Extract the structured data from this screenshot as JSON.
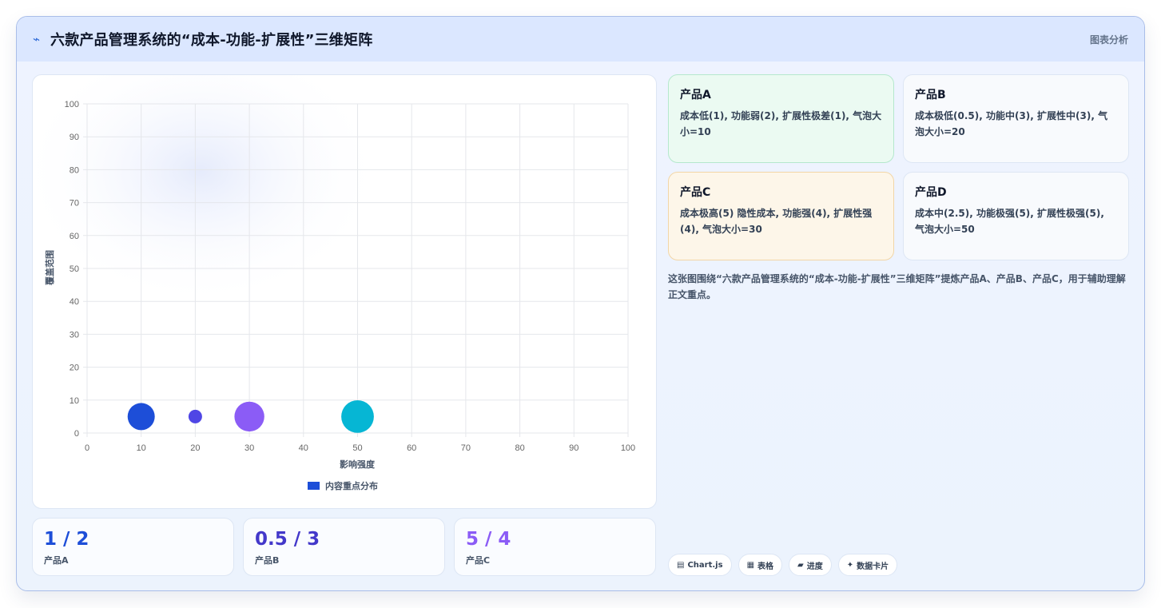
{
  "header": {
    "logo_icon": "⌁",
    "title": "六款产品管理系统的“成本-功能-扩展性”三维矩阵",
    "tag": "图表分析"
  },
  "chart_data": {
    "type": "bubble",
    "xlabel": "影响强度",
    "ylabel": "覆盖范围",
    "xlim": [
      0,
      100
    ],
    "ylim": [
      0,
      100
    ],
    "xticks": [
      0,
      10,
      20,
      30,
      40,
      50,
      60,
      70,
      80,
      90,
      100
    ],
    "yticks": [
      0,
      10,
      20,
      30,
      40,
      50,
      60,
      70,
      80,
      90,
      100
    ],
    "grid": true,
    "legend_position": "bottom",
    "series": [
      {
        "name": "内容重点分布",
        "color": "#1d4ed8",
        "points": [
          {
            "x": 10,
            "y": 5,
            "r": 10,
            "color": "#1d4ed8"
          },
          {
            "x": 20,
            "y": 5,
            "r": 5,
            "color": "#4f46e5"
          },
          {
            "x": 30,
            "y": 5,
            "r": 11,
            "color": "#8b5cf6"
          },
          {
            "x": 50,
            "y": 5,
            "r": 12,
            "color": "#06b6d4"
          }
        ]
      }
    ]
  },
  "stats": [
    {
      "value": "1 / 2",
      "label": "产品A",
      "color": "#1d4ed8"
    },
    {
      "value": "0.5 / 3",
      "label": "产品B",
      "color": "#4338ca"
    },
    {
      "value": "5 / 4",
      "label": "产品C",
      "color": "#8b5cf6"
    }
  ],
  "products": [
    {
      "name": "产品A",
      "desc": "成本低(1), 功能弱(2), 扩展性极差(1), 气泡大小=10",
      "bg": "#ebfaf2",
      "border": "#b5e8cd"
    },
    {
      "name": "产品B",
      "desc": "成本极低(0.5), 功能中(3), 扩展性中(3), 气泡大小=20",
      "bg": "#f8fafd",
      "border": "#dde6f4"
    },
    {
      "name": "产品C",
      "desc": "成本极高(5) 隐性成本, 功能强(4), 扩展性强(4), 气泡大小=30",
      "bg": "#fdf6e9",
      "border": "#f2d6a6"
    },
    {
      "name": "产品D",
      "desc": "成本中(2.5), 功能极强(5), 扩展性极强(5), 气泡大小=50",
      "bg": "#f8fafd",
      "border": "#dde6f4"
    }
  ],
  "caption": "这张图围绕“六款产品管理系统的“成本-功能-扩展性”三维矩阵”提炼产品A、产品B、产品C，用于辅助理解正文重点。",
  "chips": [
    {
      "icon": "▤",
      "label": "Chart.js"
    },
    {
      "icon": "▦",
      "label": "表格"
    },
    {
      "icon": "▰",
      "label": "进度"
    },
    {
      "icon": "✦",
      "label": "数据卡片"
    }
  ]
}
